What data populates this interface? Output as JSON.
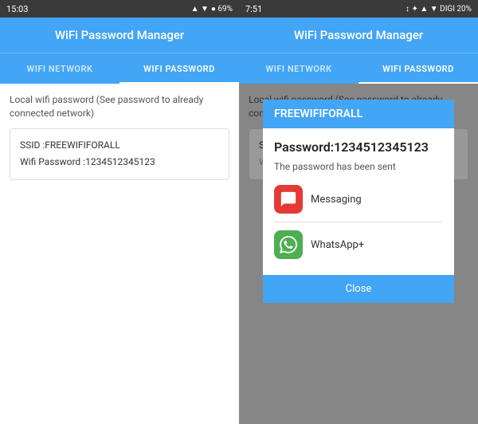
{
  "left": {
    "statusBar": {
      "time": "15:03",
      "icons": "▲ ▼ ● 69%"
    },
    "topBar": {
      "title": "WiFi Password Manager"
    },
    "tabs": [
      {
        "id": "wifi-network",
        "label": "WIFI NETWORK",
        "active": false
      },
      {
        "id": "wifi-password",
        "label": "WIFI PASSWORD",
        "active": true
      }
    ],
    "content": {
      "description": "Local wifi password (See password to already connected network)",
      "ssid": "SSID :FREEWIFIFORALL",
      "wifiPassword": "Wifi Password :1234512345123"
    }
  },
  "right": {
    "statusBar": {
      "time": "7:51",
      "icons": "DIGI 20%"
    },
    "topBar": {
      "title": "WiFi Password Manager"
    },
    "tabs": [
      {
        "id": "wifi-network",
        "label": "WIFI NETWORK",
        "active": false
      },
      {
        "id": "wifi-password",
        "label": "WIFI PASSWORD",
        "active": true
      }
    ],
    "content": {
      "description": "Local wifi password (See password to already connected network)",
      "ssid": "SSID :FREEWIFIFORALL",
      "wifiPassword": "Wifi Pass..."
    },
    "dialog": {
      "title": "FREEWIFIFORALL",
      "password": "Password:1234512345123",
      "sentText": "The password has been sent",
      "apps": [
        {
          "id": "messaging",
          "label": "Messaging"
        },
        {
          "id": "whatsapp",
          "label": "WhatsApp+"
        }
      ],
      "closeButton": "Close"
    }
  }
}
